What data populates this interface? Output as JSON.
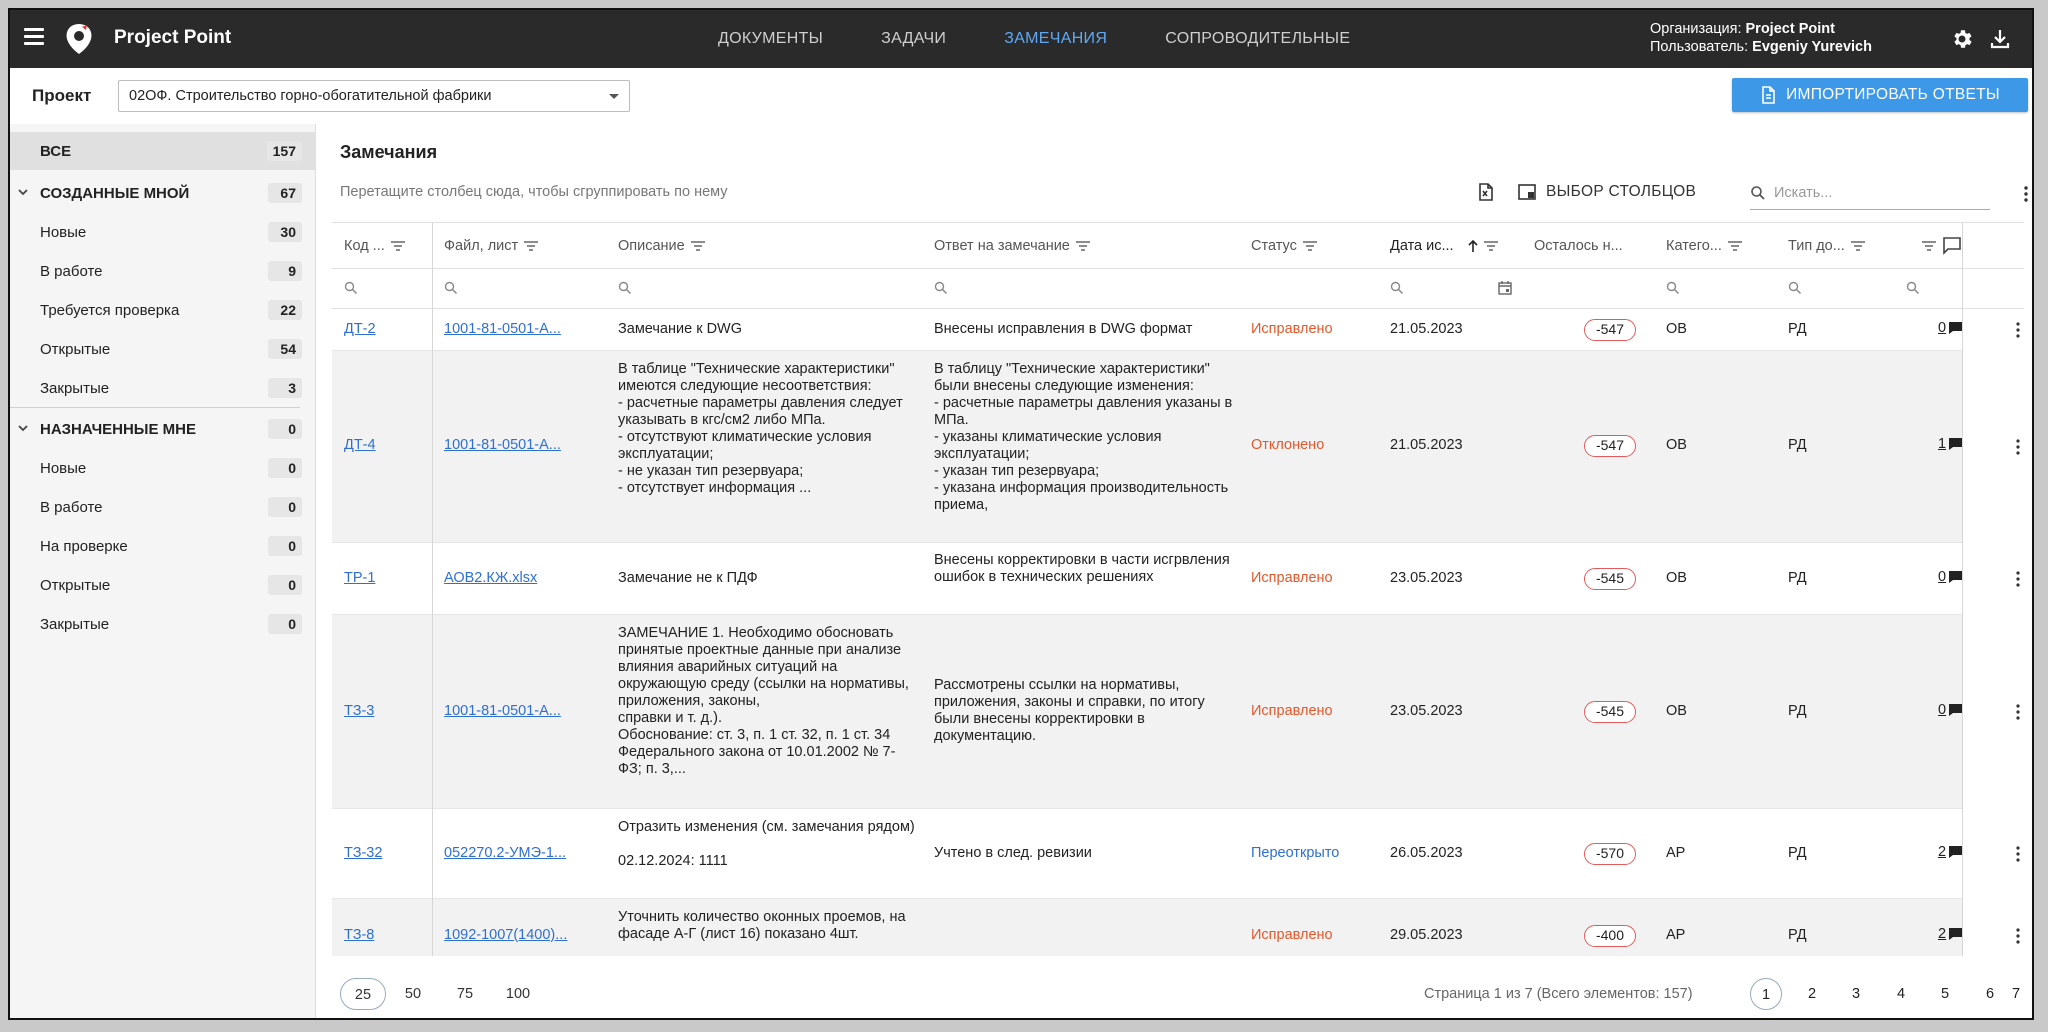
{
  "app": {
    "brand": "Project Point",
    "nav": [
      "ДОКУМЕНТЫ",
      "ЗАДАЧИ",
      "ЗАМЕЧАНИЯ",
      "СОПРОВОДИТЕЛЬНЫЕ"
    ],
    "nav_active": "ЗАМЕЧАНИЯ",
    "org_label": "Организация:",
    "org_value": "Project Point",
    "user_label": "Пользователь:",
    "user_value": "Evgeniy Yurevich"
  },
  "project": {
    "label": "Проект",
    "selected": "02ОФ. Строительство горно-обогатительной фабрики",
    "import_label": "ИМПОРТИРОВАТЬ ОТВЕТЫ"
  },
  "sidebar": {
    "all": {
      "label": "ВСЕ",
      "count": "157"
    },
    "created": {
      "label": "СОЗДАННЫЕ МНОЙ",
      "count": "67"
    },
    "created_items": [
      {
        "label": "Новые",
        "count": "30"
      },
      {
        "label": "В работе",
        "count": "9"
      },
      {
        "label": "Требуется проверка",
        "count": "22"
      },
      {
        "label": "Открытые",
        "count": "54"
      },
      {
        "label": "Закрытые",
        "count": "3"
      }
    ],
    "assigned": {
      "label": "НАЗНАЧЕННЫЕ МНЕ",
      "count": "0"
    },
    "assigned_items": [
      {
        "label": "Новые",
        "count": "0"
      },
      {
        "label": "В работе",
        "count": "0"
      },
      {
        "label": "На проверке",
        "count": "0"
      },
      {
        "label": "Открытые",
        "count": "0"
      },
      {
        "label": "Закрытые",
        "count": "0"
      }
    ]
  },
  "main": {
    "title": "Замечания",
    "group_hint": "Перетащите столбец сюда, чтобы сгруппировать по нему",
    "columns_button": "ВЫБОР СТОЛБЦОВ",
    "search_placeholder": "Искать...",
    "columns": [
      "Код ...",
      "Файл, лист",
      "Описание",
      "Ответ на замечание",
      "Статус",
      "Дата ис...",
      "Осталось н...",
      "Катего...",
      "Тип до..."
    ],
    "rows": [
      {
        "code": "ДТ-2",
        "file": "1001-81-0501-A...",
        "desc": "Замечание к DWG",
        "answer": "Внесены исправления в DWG формат",
        "status": "Исправлено",
        "status_color": "#e2582a",
        "date": "21.05.2023",
        "left": "-547",
        "cat": "ОВ",
        "type": "РД",
        "comments": "0"
      },
      {
        "code": "ДТ-4",
        "file": "1001-81-0501-A...",
        "desc": "В таблице \"Технические характеристики\" имеются следующие несоответствия:\n- расчетные  параметры давления следует указывать в кгс/см2 либо МПа.\n- отсутствуют климатические условия эксплуатации;\n- не указан тип резервуара;\n- отсутствует информация ...",
        "answer": "В таблицу \"Технические характеристики\" были внесены следующие изменения:\n- расчетные  параметры давления указаны  в МПа.\n- указаны климатические условия эксплуатации;\n- указан тип резервуара;\n- указана информация производительность приема,",
        "status": "Отклонено",
        "status_color": "#e2582a",
        "date": "21.05.2023",
        "left": "-547",
        "cat": "ОВ",
        "type": "РД",
        "comments": "1"
      },
      {
        "code": "ТР-1",
        "file": "АОВ2.КЖ.xlsx",
        "desc": "Замечание не к ПДФ",
        "answer": "Внесены корректировки в части исгрвления ошибок в технических решениях",
        "status": "Исправлено",
        "status_color": "#e2582a",
        "date": "23.05.2023",
        "left": "-545",
        "cat": "ОВ",
        "type": "РД",
        "comments": "0"
      },
      {
        "code": "ТЗ-3",
        "file": "1001-81-0501-A...",
        "desc": "ЗАМЕЧАНИЕ 1. Необходимо обосновать принятые проектные данные при анализе влияния аварийных ситуаций на окружающую среду (ссылки на нормативы, приложения, законы,\nсправки и т. д.).\nОбоснование: ст. 3, п. 1 ст. 32, п. 1 ст. 34 Федерального закона от 10.01.2002 № 7-ФЗ; п. 3,...",
        "answer": "Рассмотрены ссылки на нормативы, приложения, законы и справки, по итогу были внесены корректировки в документацию.",
        "status": "Исправлено",
        "status_color": "#e2582a",
        "date": "23.05.2023",
        "left": "-545",
        "cat": "ОВ",
        "type": "РД",
        "comments": "0"
      },
      {
        "code": "ТЗ-32",
        "file": "052270.2-УМЭ-1...",
        "desc": "Отразить изменения (см. замечания рядом)\n\n02.12.2024: 1111",
        "answer": "Учтено в след. ревизии",
        "status": "Переоткрыто",
        "status_color": "#2e6fd1",
        "date": "26.05.2023",
        "left": "-570",
        "cat": "АР",
        "type": "РД",
        "comments": "2"
      },
      {
        "code": "ТЗ-8",
        "file": "1092-1007(1400)...",
        "desc": "Уточнить количество оконных проемов, на фасаде А-Г (лист 16) показано 4шт.",
        "answer": "",
        "status": "Исправлено",
        "status_color": "#e2582a",
        "date": "29.05.2023",
        "left": "-400",
        "cat": "АР",
        "type": "РД",
        "comments": "2"
      }
    ]
  },
  "pager": {
    "sizes": [
      "25",
      "50",
      "75",
      "100"
    ],
    "selected_size": "25",
    "info": "Страница 1 из 7 (Всего элементов: 157)",
    "pages": [
      "1",
      "2",
      "3",
      "4",
      "5",
      "6",
      "7"
    ],
    "current": "1"
  }
}
